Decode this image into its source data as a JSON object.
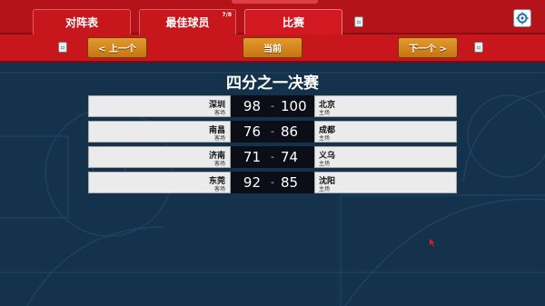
{
  "tabs": [
    {
      "label": "对阵表"
    },
    {
      "label": "最佳球员",
      "badge": "7/8"
    },
    {
      "label": "比赛"
    }
  ],
  "icons": {
    "small_button_1": "small-square-icon",
    "small_button_2": "small-square-icon",
    "small_button_3": "small-square-icon",
    "settings": "gear-icon",
    "cursor": "mouse-cursor-icon"
  },
  "nav": {
    "prev_label": "< 上一个",
    "current_label": "当前",
    "next_label": "下一个 >"
  },
  "round_title": "四分之一决赛",
  "matches": [
    {
      "away": "深圳",
      "away_sub": "客场",
      "away_score": "98",
      "dash": "-",
      "home_score": "100",
      "home": "北京",
      "home_sub": "主场"
    },
    {
      "away": "南昌",
      "away_sub": "客场",
      "away_score": "76",
      "dash": "-",
      "home_score": "86",
      "home": "成都",
      "home_sub": "主场"
    },
    {
      "away": "济南",
      "away_sub": "客场",
      "away_score": "71",
      "dash": "-",
      "home_score": "74",
      "home": "义乌",
      "home_sub": "主场"
    },
    {
      "away": "东莞",
      "away_sub": "客场",
      "away_score": "92",
      "dash": "-",
      "home_score": "85",
      "home": "沈阳",
      "home_sub": "主场"
    }
  ],
  "colors": {
    "header_red": "#b5131a",
    "nav_red": "#c8161d",
    "button_orange": "#d98a20",
    "court_blue": "#14324c",
    "score_bg": "#0b0e16"
  }
}
